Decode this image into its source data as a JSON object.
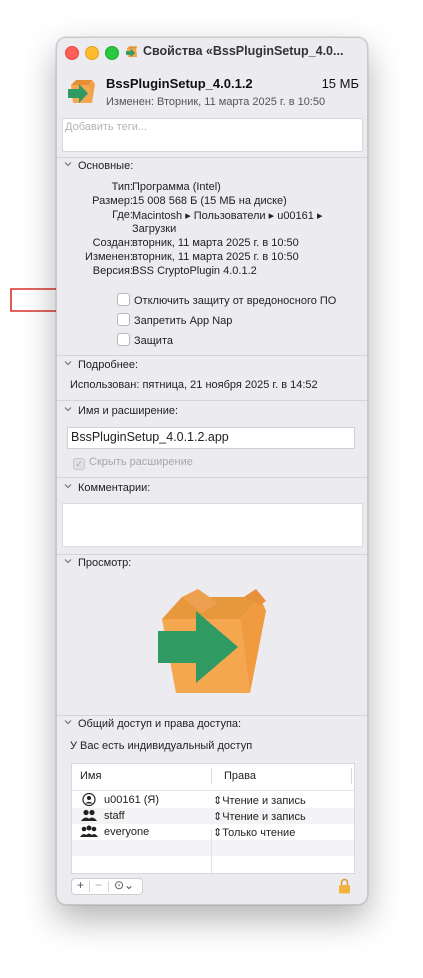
{
  "window": {
    "title": "Свойства «BssPluginSetup_4.0...",
    "file_name": "BssPluginSetup_4.0.1.2",
    "file_size": "15 МБ",
    "modified_line": "Изменен: Вторник, 11 марта 2025 г. в 10:50",
    "tags_placeholder": "Добавить теги..."
  },
  "general": {
    "header": "Основные:",
    "rows": [
      {
        "key": "Тип:",
        "value": "Программа (Intel)"
      },
      {
        "key": "Размер:",
        "value": "15 008 568 Б (15 МБ на диске)"
      },
      {
        "key": "Где:",
        "value": "Macintosh ▸ Пользователи ▸ u00161 ▸"
      },
      {
        "key": "",
        "value": "Загрузки"
      },
      {
        "key": "Создан:",
        "value": "вторник, 11 марта 2025 г. в 10:50"
      },
      {
        "key": "Изменен:",
        "value": "вторник, 11 марта 2025 г. в 10:50"
      },
      {
        "key": "Версия:",
        "value": "BSS CryptoPlugin 4.0.1.2"
      }
    ],
    "checkboxes": [
      {
        "label": "Отключить защиту от вредоносного ПО",
        "checked": false
      },
      {
        "label": "Запретить App Nap",
        "checked": false
      },
      {
        "label": "Защита",
        "checked": false
      }
    ]
  },
  "more_info": {
    "header": "Подробнее:",
    "last_used": "Использован: пятница, 21 ноября 2025 г. в 14:52"
  },
  "name_ext": {
    "header": "Имя и расширение:",
    "value": "BssPluginSetup_4.0.1.2.app",
    "hide_extension": "Скрыть расширение",
    "hide_extension_checked": true
  },
  "comments": {
    "header": "Комментарии:"
  },
  "preview": {
    "header": "Просмотр:"
  },
  "sharing": {
    "header": "Общий доступ и права доступа:",
    "access_note": "У Вас есть индивидуальный доступ",
    "col_name": "Имя",
    "col_perm": "Права",
    "rows": [
      {
        "icon": "user-icon",
        "name": "u00161 (Я)",
        "perm": "Чтение и запись"
      },
      {
        "icon": "group-icon",
        "name": "staff",
        "perm": "Чтение и запись"
      },
      {
        "icon": "everyone-icon",
        "name": "everyone",
        "perm": "Только чтение"
      }
    ],
    "add_label": "+",
    "remove_label": "−",
    "action_label": "⊙⌄"
  },
  "colors": {
    "icon_orange": "#f5a74f",
    "icon_green": "#2f9a62",
    "annotation_red": "#d8322f"
  }
}
